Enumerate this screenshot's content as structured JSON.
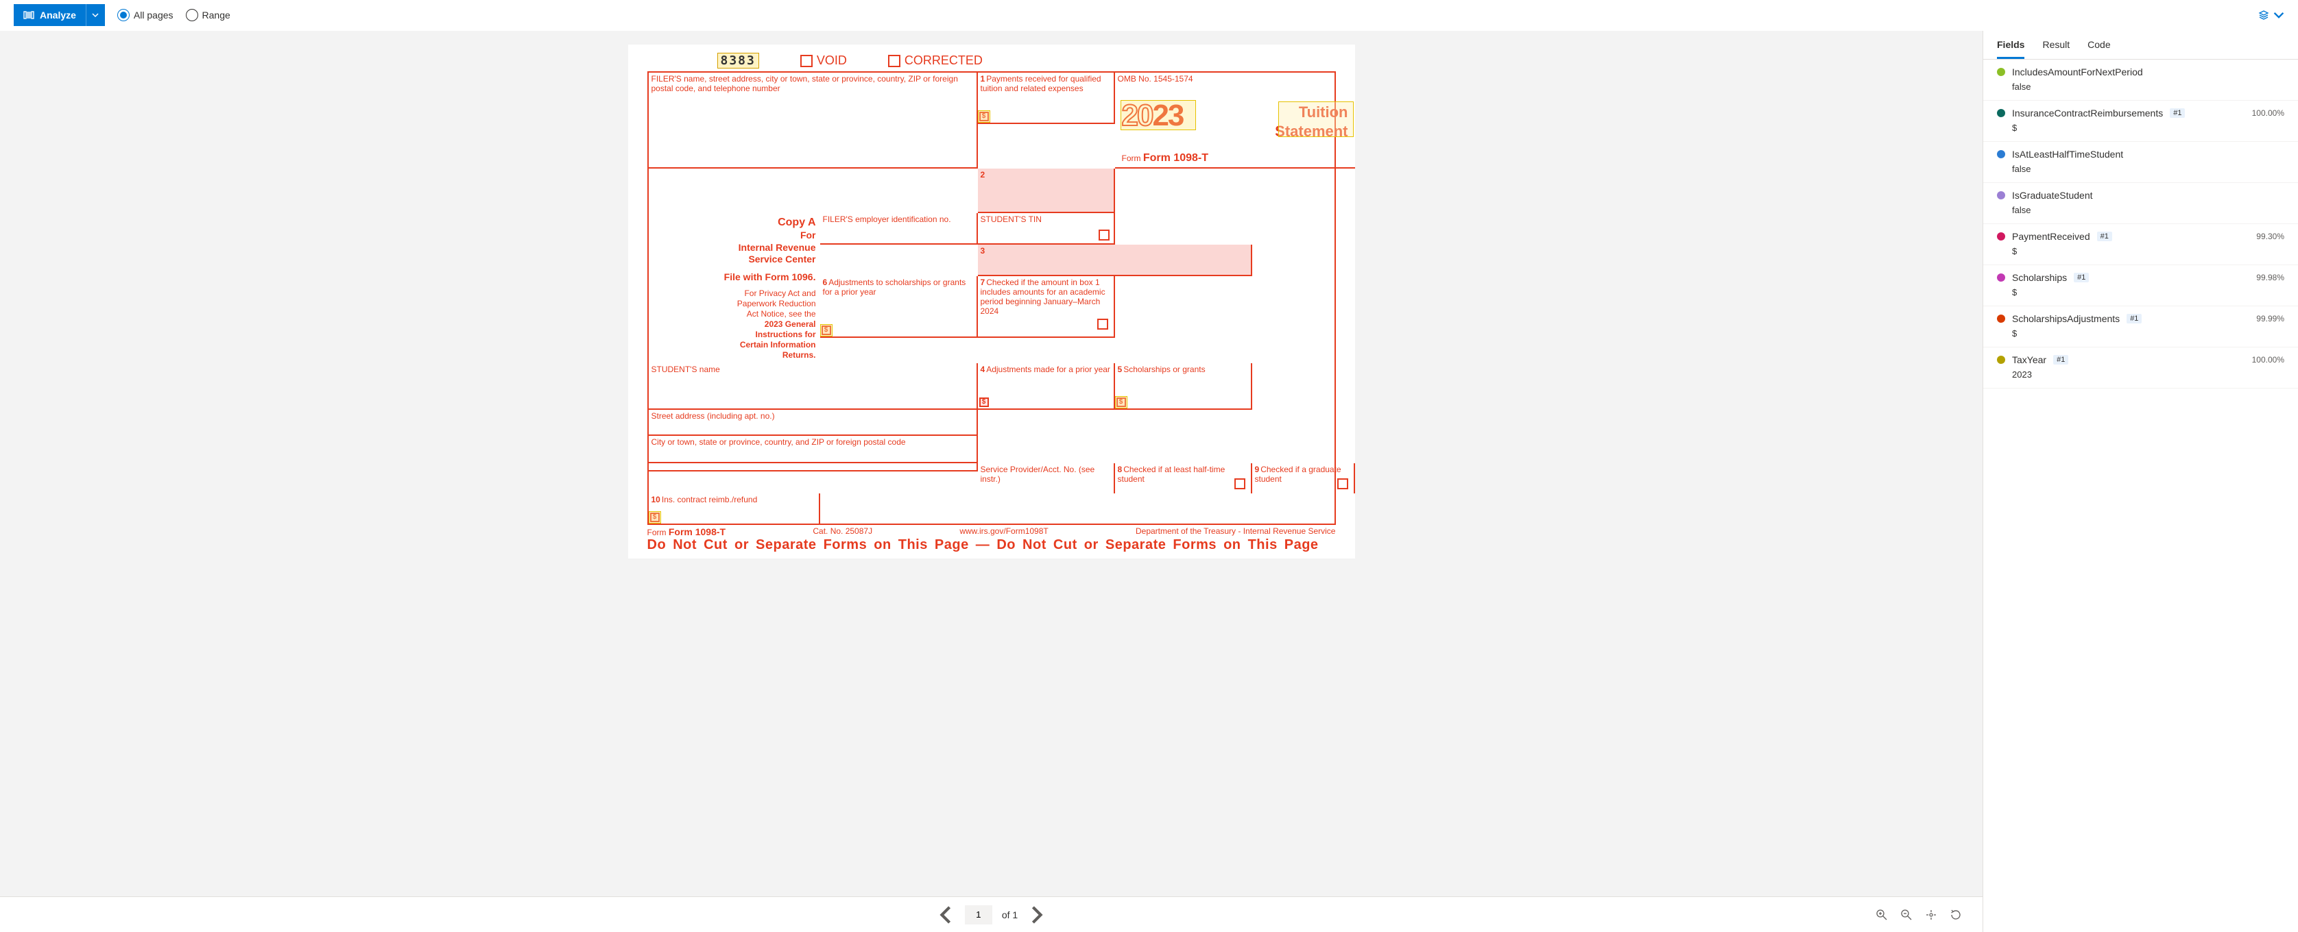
{
  "toolbar": {
    "analyze_label": "Analyze",
    "all_pages_label": "All pages",
    "range_label": "Range"
  },
  "form": {
    "ocr_code": "8383",
    "void_label": "VOID",
    "corrected_label": "CORRECTED",
    "filer_label": "FILER'S name, street address, city or town, state or province, country, ZIP or foreign postal code, and telephone number",
    "box1_label": "Payments received for qualified tuition and related expenses",
    "omb": "OMB No. 1545-1574",
    "year_20": "20",
    "year_23": "23",
    "form_no": "Form 1098-T",
    "title1": "Tuition",
    "title2": "Statement",
    "filer_ein_label": "FILER'S employer identification no.",
    "student_tin_label": "STUDENT'S TIN",
    "student_name_label": "STUDENT'S name",
    "box4_label": "Adjustments made for a prior year",
    "box5_label": "Scholarships or grants",
    "street_label": "Street address (including apt. no.)",
    "city_label": "City or town, state or province, country, and ZIP or foreign postal code",
    "box6_label": "Adjustments to scholarships or grants for a prior year",
    "box7_label": "Checked if the amount in box 1 includes amounts for an academic period beginning January–March 2024",
    "provider_label": "Service Provider/Acct. No. (see instr.)",
    "box8_label": "Checked if at least half-time student",
    "box9_label": "Checked if a graduate student",
    "box10_label": "Ins. contract reimb./refund",
    "copy_a": "Copy A",
    "copy_for": "For",
    "copy_irs1": "Internal Revenue",
    "copy_irs2": "Service Center",
    "file_with": "File with Form 1096.",
    "notice1": "For Privacy Act and",
    "notice2": "Paperwork Reduction",
    "notice3": "Act Notice, see the",
    "notice4": "2023 General",
    "notice5": "Instructions for",
    "notice6": "Certain Information",
    "notice7": "Returns.",
    "foot_form": "Form 1098-T",
    "foot_cat": "Cat. No. 25087J",
    "foot_url": "www.irs.gov/Form1098T",
    "foot_dept": "Department of the Treasury - Internal Revenue Service",
    "warn": "Do Not Cut or Separate Forms on This Page   —   Do Not Cut or Separate Forms on This Page"
  },
  "pager": {
    "page": "1",
    "of_label": "of 1"
  },
  "tabs": {
    "fields": "Fields",
    "result": "Result",
    "code": "Code"
  },
  "fields": [
    {
      "color": "#8cbf26",
      "name": "IncludesAmountForNextPeriod",
      "badge": "",
      "conf": "",
      "value": "false"
    },
    {
      "color": "#0b6a5f",
      "name": "InsuranceContractReimbursements",
      "badge": "#1",
      "conf": "100.00%",
      "value": "$"
    },
    {
      "color": "#2b7cd3",
      "name": "IsAtLeastHalfTimeStudent",
      "badge": "",
      "conf": "",
      "value": "false"
    },
    {
      "color": "#9b7fd4",
      "name": "IsGraduateStudent",
      "badge": "",
      "conf": "",
      "value": "false"
    },
    {
      "color": "#d1185f",
      "name": "PaymentReceived",
      "badge": "#1",
      "conf": "99.30%",
      "value": "$"
    },
    {
      "color": "#c239b3",
      "name": "Scholarships",
      "badge": "#1",
      "conf": "99.98%",
      "value": "$"
    },
    {
      "color": "#d83b01",
      "name": "ScholarshipsAdjustments",
      "badge": "#1",
      "conf": "99.99%",
      "value": "$"
    },
    {
      "color": "#b3a100",
      "name": "TaxYear",
      "badge": "#1",
      "conf": "100.00%",
      "value": "2023"
    }
  ]
}
